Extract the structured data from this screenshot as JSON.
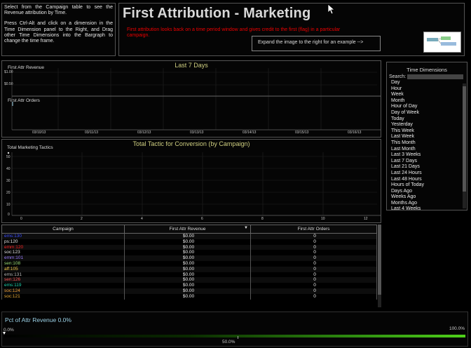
{
  "instructions": {
    "p1": "Select from the Campaign table to see the Revenue attribution by Time.",
    "p2": "Press Ctrl-Alt and click on a dimension in the Time Dimension panel to the Right, and Drag other Time Dimensions into the Bargraph to change the time frame."
  },
  "header": {
    "title": "First Attribution - Marketing",
    "description": "First attribution looks back on a time period window and gives credit to the first (flag) in a particular campaign.",
    "expand_text": "Expand the image to the right for an example -->"
  },
  "chart_last7": {
    "title": "Last 7 Days",
    "revenue_label": "First Attr Revenue",
    "orders_label": "First Attr Orders",
    "y_ticks": [
      "$1.00",
      "$0.50"
    ],
    "x_ticks": [
      "03/10/13",
      "03/11/13",
      "03/12/13",
      "03/13/13",
      "03/14/13",
      "03/15/13",
      "03/16/13"
    ]
  },
  "chart_tactic": {
    "title": "Total Tactic for Conversion (by Campaign)",
    "y_label": "Total Marketing Tactics",
    "y_ticks": [
      "50",
      "40",
      "30",
      "20",
      "10",
      "0"
    ],
    "x_ticks": [
      "0",
      "2",
      "4",
      "6",
      "8",
      "10",
      "12"
    ]
  },
  "time_dimensions": {
    "title": "Time Dimensions",
    "search_label": "Search:",
    "items": [
      "Day",
      "Hour",
      "Week",
      "Month",
      "Hour of Day",
      "Day of Week",
      "Today",
      "Yesterday",
      "This Week",
      "Last Week",
      "This Month",
      "Last Month",
      "Last 3 Weeks",
      "Last 7 Days",
      "Last 21 Days",
      "Last 24 Hours",
      "Last 48 Hours",
      "Hours of Today",
      "Days Ago",
      "Weeks Ago",
      "Months Ago",
      "Last 4 Weeks"
    ]
  },
  "campaign_table": {
    "columns": [
      "Campaign",
      "First Attr Revenue",
      "First Attr Orders"
    ],
    "rows": [
      {
        "campaign": "ems:130",
        "revenue": "$0.00",
        "orders": "0",
        "color": "#3a4dff"
      },
      {
        "campaign": "ps:120",
        "revenue": "$0.00",
        "orders": "0",
        "color": "#e6e6e6"
      },
      {
        "campaign": "emm:120",
        "revenue": "$0.00",
        "orders": "0",
        "color": "#ff2222"
      },
      {
        "campaign": "soc:123",
        "revenue": "$0.00",
        "orders": "0",
        "color": "#e6e6e6"
      },
      {
        "campaign": "emm:101",
        "revenue": "$0.00",
        "orders": "0",
        "color": "#9a7cff"
      },
      {
        "campaign": "sen:108",
        "revenue": "$0.00",
        "orders": "0",
        "color": "#9fe07a"
      },
      {
        "campaign": "aff:105",
        "revenue": "$0.00",
        "orders": "0",
        "color": "#f0c94a"
      },
      {
        "campaign": "ems:131",
        "revenue": "$0.00",
        "orders": "0",
        "color": "#bbbbbb"
      },
      {
        "campaign": "sen:126",
        "revenue": "$0.00",
        "orders": "0",
        "color": "#ff5a5a"
      },
      {
        "campaign": "ems:119",
        "revenue": "$0.00",
        "orders": "0",
        "color": "#1ed6b0"
      },
      {
        "campaign": "soc:124",
        "revenue": "$0.00",
        "orders": "0",
        "color": "#f0a23a"
      },
      {
        "campaign": "soc:121",
        "revenue": "$0.00",
        "orders": "0",
        "color": "#f0b23a"
      }
    ]
  },
  "pct_panel": {
    "title": "Pct of Attr Revenue 0.0%",
    "min_label": "0.0%",
    "mid_label": "50.0%",
    "max_label": "100.0%",
    "value_fraction": 0.0
  }
}
